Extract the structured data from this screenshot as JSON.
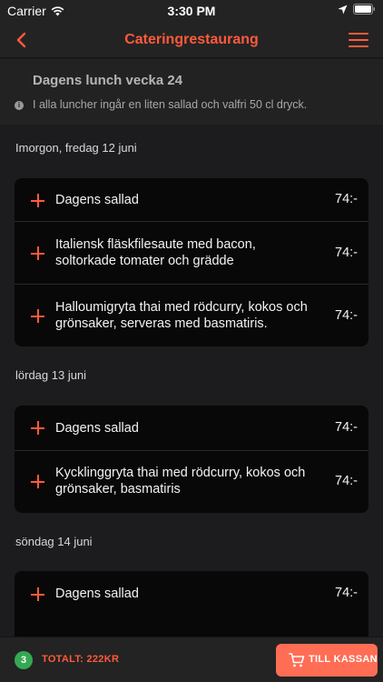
{
  "status_bar": {
    "carrier": "Carrier",
    "time": "3:30 PM"
  },
  "nav": {
    "title": "Cateringrestaurang",
    "icons": [
      "back-chevron",
      "hamburger-menu"
    ]
  },
  "intro": {
    "heading": "Dagens lunch vecka 24",
    "note": "I alla luncher ingår en liten sallad och valfri 50 cl dryck."
  },
  "days": [
    {
      "label": "Imorgon, fredag 12 juni",
      "items": [
        {
          "name": "Dagens sallad",
          "price": "74:-"
        },
        {
          "name": "Italiensk fläskfilesaute med bacon, soltorkade tomater och grädde",
          "price": "74:-"
        },
        {
          "name": "Halloumigryta thai med rödcurry, kokos och grönsaker, serveras med basmatiris.",
          "price": "74:-"
        }
      ]
    },
    {
      "label": "lördag 13 juni",
      "items": [
        {
          "name": "Dagens sallad",
          "price": "74:-"
        },
        {
          "name": "Kycklinggryta thai med rödcurry, kokos och grönsaker, basmatiris",
          "price": "74:-"
        }
      ]
    },
    {
      "label": "söndag 14 juni",
      "items": [
        {
          "name": "Dagens sallad",
          "price": "74:-"
        }
      ]
    }
  ],
  "cart": {
    "count": "3",
    "total": "TOTALT: 222KR",
    "checkout_label": "TILL KASSAN"
  },
  "colors": {
    "accent": "#ff5a3c",
    "background": "#1c1c1e",
    "card": "#080808",
    "badge": "#34a853"
  }
}
